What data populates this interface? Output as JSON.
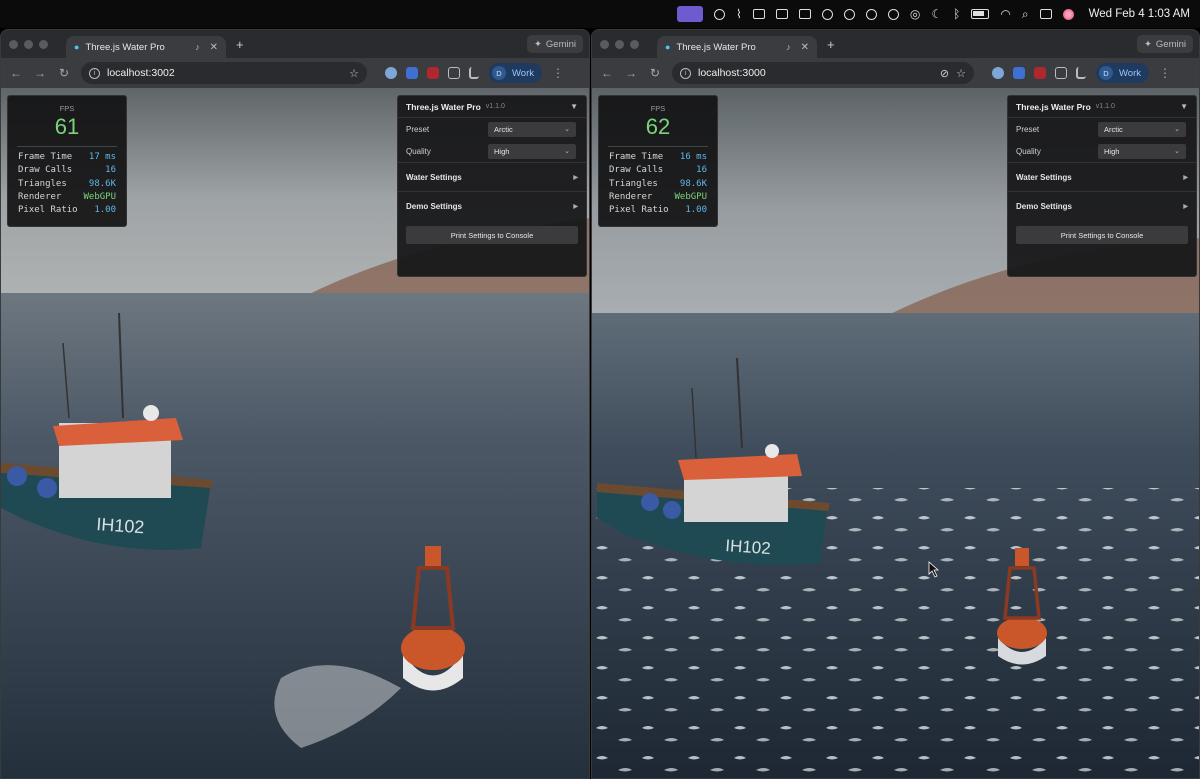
{
  "menubar": {
    "clock": "Wed Feb 4  1:03 AM"
  },
  "windows": [
    {
      "tab_title": "Three.js Water Pro",
      "url": "localhost:3002",
      "gemini_label": "Gemini",
      "profile_initial": "D",
      "profile_label": "Work",
      "stats": {
        "fps_label": "FPS",
        "fps": "61",
        "rows": [
          {
            "label": "Frame Time",
            "value": "17 ms"
          },
          {
            "label": "Draw Calls",
            "value": "16"
          },
          {
            "label": "Triangles",
            "value": "98.6K"
          },
          {
            "label": "Renderer",
            "value": "WebGPU"
          },
          {
            "label": "Pixel Ratio",
            "value": "1.00"
          }
        ]
      },
      "gui": {
        "title": "Three.js Water Pro",
        "version": "v1.1.0",
        "preset_label": "Preset",
        "preset_value": "Arctic",
        "quality_label": "Quality",
        "quality_value": "High",
        "folders": [
          "Water Settings",
          "Demo Settings"
        ],
        "button": "Print Settings to Console"
      }
    },
    {
      "tab_title": "Three.js Water Pro",
      "url": "localhost:3000",
      "gemini_label": "Gemini",
      "profile_initial": "D",
      "profile_label": "Work",
      "stats": {
        "fps_label": "FPS",
        "fps": "62",
        "rows": [
          {
            "label": "Frame Time",
            "value": "16 ms"
          },
          {
            "label": "Draw Calls",
            "value": "16"
          },
          {
            "label": "Triangles",
            "value": "98.6K"
          },
          {
            "label": "Renderer",
            "value": "WebGPU"
          },
          {
            "label": "Pixel Ratio",
            "value": "1.00"
          }
        ]
      },
      "gui": {
        "title": "Three.js Water Pro",
        "version": "v1.1.0",
        "preset_label": "Preset",
        "preset_value": "Arctic",
        "quality_label": "Quality",
        "quality_value": "High",
        "folders": [
          "Water Settings",
          "Demo Settings"
        ],
        "button": "Print Settings to Console"
      }
    }
  ],
  "boat_hull_text": "IH102",
  "colors": {
    "fps_green": "#7cd37c",
    "value_blue": "#5fb8e8",
    "boat_cabin": "#d9603a",
    "boat_hull": "#1f4a54",
    "buoy": "#c9572a"
  }
}
